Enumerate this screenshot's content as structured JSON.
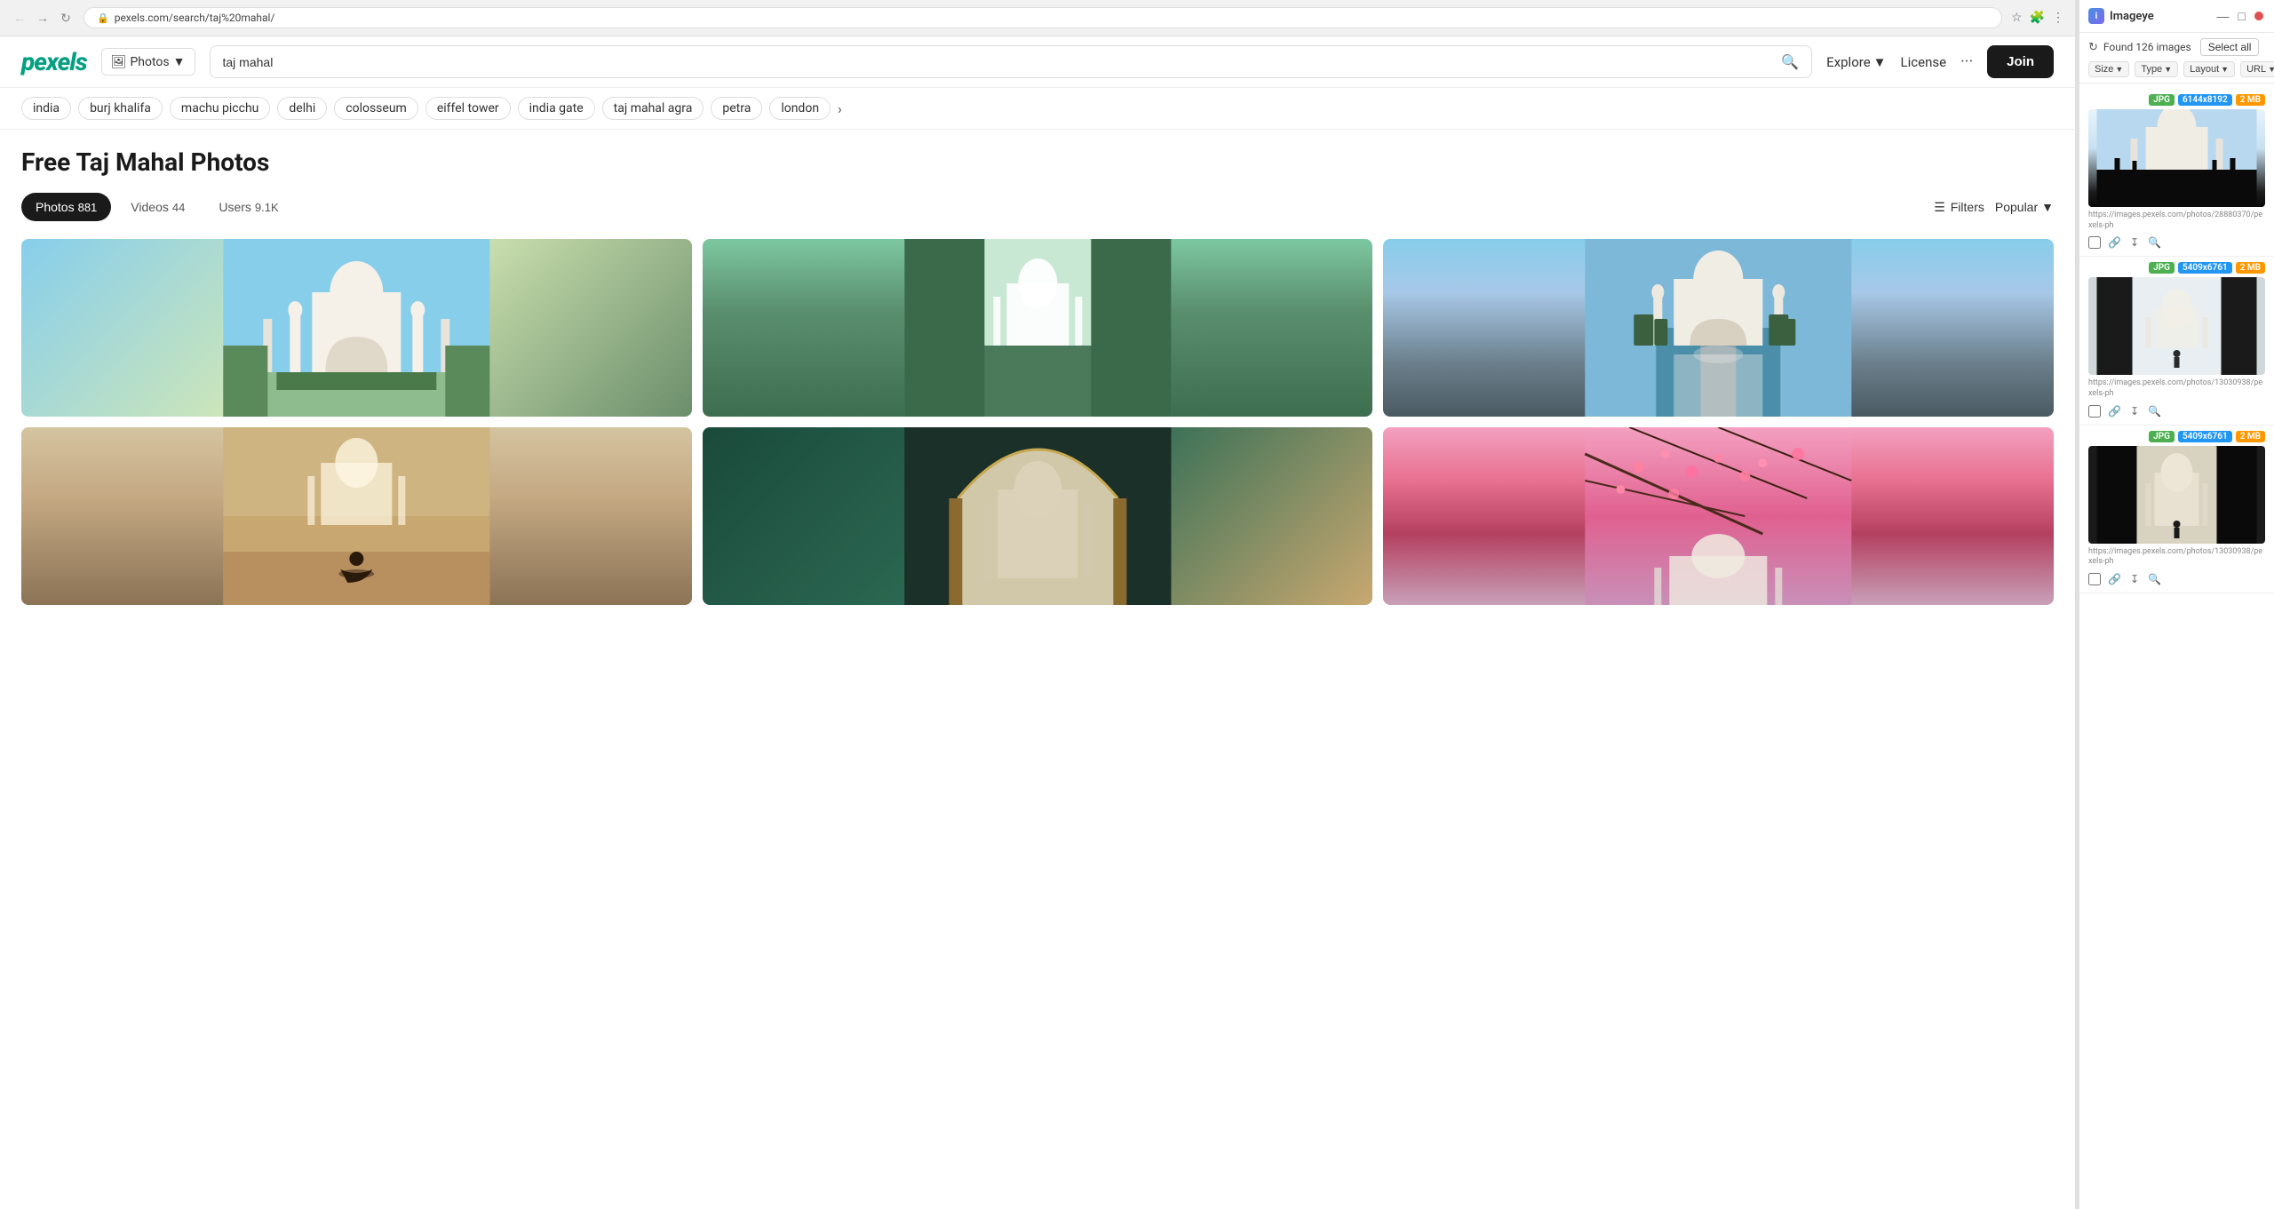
{
  "browser": {
    "url": "pexels.com/search/taj%20mahal/",
    "favicon": "🔒"
  },
  "header": {
    "logo": "pexels",
    "photos_dropdown": "Photos",
    "search_placeholder": "taj mahal",
    "search_value": "taj mahal",
    "nav_explore": "Explore",
    "nav_license": "License",
    "nav_more": "···",
    "join_label": "Join"
  },
  "tags": [
    "india",
    "burj khalifa",
    "machu picchu",
    "delhi",
    "colosseum",
    "eiffel tower",
    "india gate",
    "taj mahal agra",
    "petra",
    "london"
  ],
  "page": {
    "title": "Free Taj Mahal Photos",
    "tab_photos": "Photos",
    "tab_photos_count": "881",
    "tab_videos": "Videos",
    "tab_videos_count": "44",
    "tab_users": "Users",
    "tab_users_count": "9.1K",
    "filters_label": "Filters",
    "sort_label": "Popular"
  },
  "photos": [
    {
      "id": 1,
      "alt": "Taj Mahal front view with gardens",
      "color_class": "photo-1"
    },
    {
      "id": 2,
      "alt": "Taj Mahal through trees",
      "color_class": "photo-2"
    },
    {
      "id": 3,
      "alt": "Taj Mahal reflection pool",
      "color_class": "photo-3"
    },
    {
      "id": 4,
      "alt": "Person meditating before Taj Mahal",
      "color_class": "photo-4"
    },
    {
      "id": 5,
      "alt": "Taj Mahal through arch gate",
      "color_class": "photo-5"
    },
    {
      "id": 6,
      "alt": "Taj Mahal with cherry blossoms",
      "color_class": "photo-6"
    }
  ],
  "imageye": {
    "logo_text": "Imageye",
    "found_count": "Found 126 images",
    "select_all": "Select all",
    "filter_size": "Size",
    "filter_type": "Type",
    "filter_layout": "Layout",
    "filter_url": "URL",
    "images": [
      {
        "format": "JPG",
        "dimensions": "6144x8192",
        "size": "2 MB",
        "url": "https://images.pexels.com/photos/28880370/pexels-ph",
        "color_class": "img-taj-1"
      },
      {
        "format": "JPG",
        "dimensions": "5409x6761",
        "size": "2 MB",
        "url": "https://images.pexels.com/photos/13030938/pexels-ph",
        "color_class": "img-taj-2"
      },
      {
        "format": "JPG",
        "dimensions": "5409x6761",
        "size": "2 MB",
        "url": "https://images.pexels.com/photos/13030938/pexels-ph",
        "color_class": "img-taj-3"
      }
    ]
  }
}
